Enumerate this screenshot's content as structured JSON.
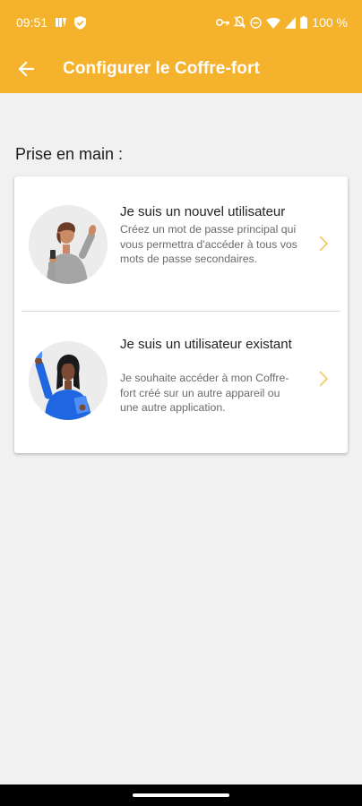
{
  "status_bar": {
    "time": "09:51",
    "battery": "100 %",
    "left_icons": [
      "notification-icon",
      "shield-icon"
    ],
    "right_icons": [
      "key-icon",
      "mute-icon",
      "dnd-icon",
      "wifi-icon",
      "signal-icon",
      "battery-icon"
    ]
  },
  "app_bar": {
    "title": "Configurer le Coffre-fort",
    "back_icon": "arrow-back-icon",
    "color": "#f4b22d"
  },
  "section": {
    "label": "Prise en main :"
  },
  "options": [
    {
      "title": "Je suis un nouvel utilisateur",
      "description": "Créez un mot de passe principal qui vous permettra d'accéder à tous vos mots de passe secondaires.",
      "illustration": "person-waving-icon",
      "chevron": "chevron-right-icon"
    },
    {
      "title": "Je suis un utilisateur existant",
      "description": "Je souhaite accéder à mon Coffre-fort créé sur un autre appareil ou une autre application.",
      "illustration": "person-with-phone-icon",
      "chevron": "chevron-right-icon"
    }
  ],
  "colors": {
    "accent": "#f4b22d",
    "background": "#f1f1f1",
    "chevron": "#f6c96a",
    "illustration_blue": "#1f67e0"
  }
}
